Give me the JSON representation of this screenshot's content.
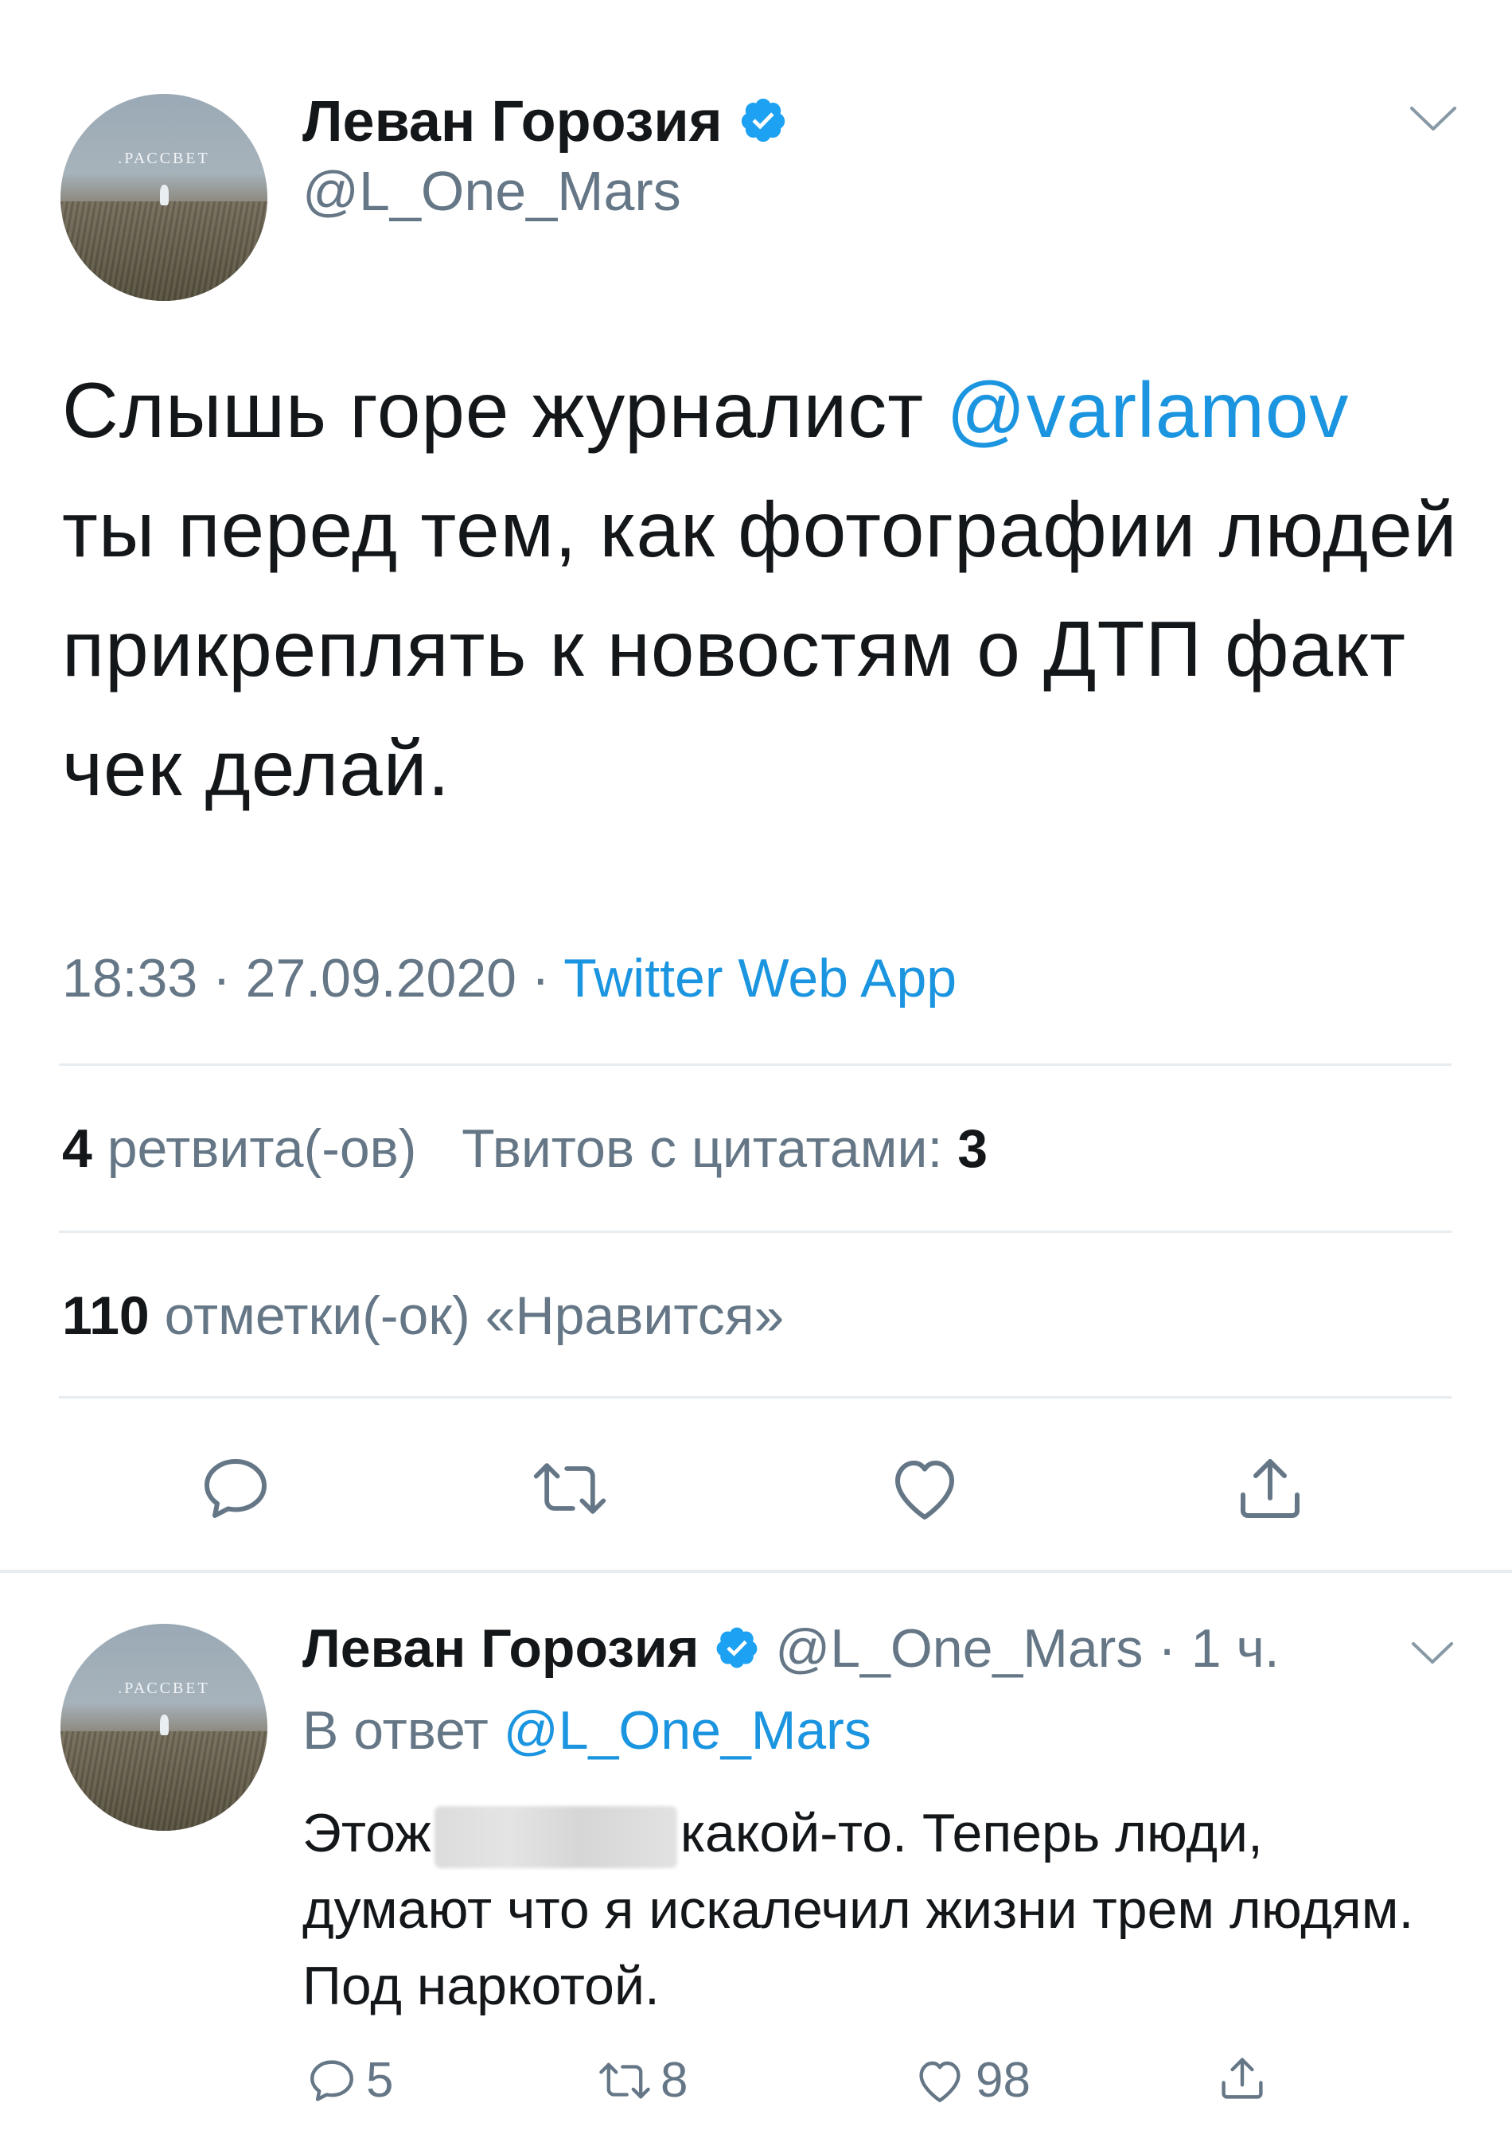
{
  "tweet": {
    "author": {
      "name": "Леван Горозия",
      "handle": "@L_One_Mars",
      "verified": true,
      "avatar_caption": ".РАССВЕТ"
    },
    "text_parts": {
      "before_mention": "Слышь горе журналист ",
      "mention": "@varlamov",
      "after_mention": " ты перед тем, как фотографии людей прикреплять к новостям о ДТП факт чек делай."
    },
    "time": "18:33",
    "date": "27.09.2020",
    "separator": "·",
    "source": "Twitter Web App",
    "retweets_count": "4",
    "retweets_label": "ретвита(-ов)",
    "quotes_label": "Твитов с цитатами:",
    "quotes_count": "3",
    "likes_count": "110",
    "likes_label": "отметки(-ок) «Нравится»",
    "actions": [
      "reply-icon",
      "retweet-icon",
      "like-icon",
      "share-icon"
    ]
  },
  "reply": {
    "author": {
      "name": "Леван Горозия",
      "handle": "@L_One_Mars",
      "time_ago": "· 1 ч.",
      "verified": true,
      "avatar_caption": ".РАССВЕТ"
    },
    "in_reply_to_label": "В ответ",
    "in_reply_to_handle": "@L_One_Mars",
    "text_before_blur": "Этож",
    "text_after_blur": "какой-то. Теперь люди, думают что я искалечил жизни трем людям. Под наркотой.",
    "reply_count": "5",
    "retweet_count": "8",
    "like_count": "98"
  },
  "colors": {
    "link": "#1b95e0",
    "secondary": "#657786",
    "primary": "#14171a",
    "divider": "#e6ecf0"
  }
}
